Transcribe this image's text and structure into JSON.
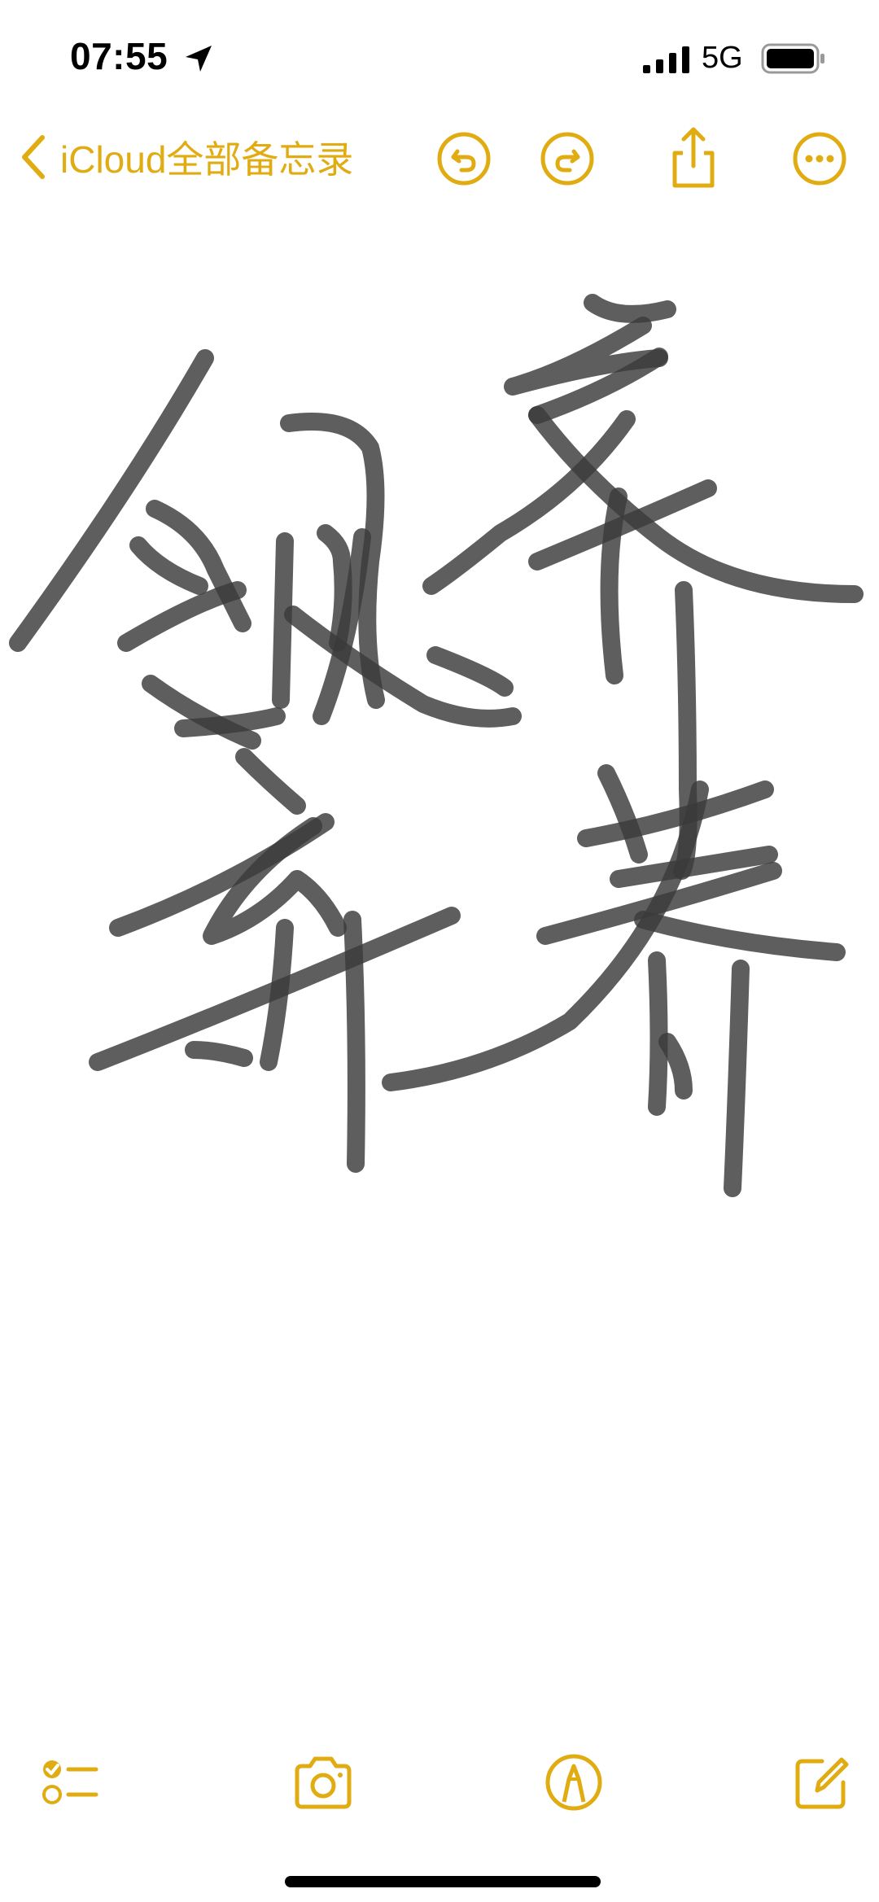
{
  "status_bar": {
    "time": "07:55",
    "network": "5G",
    "icons": [
      "location-arrow-icon",
      "cellular-signal-icon",
      "battery-icon"
    ]
  },
  "nav": {
    "back_label": "iCloud全部备忘录",
    "icons": [
      "chevron-left-icon",
      "undo-icon",
      "redo-icon",
      "share-icon",
      "more-icon"
    ]
  },
  "note": {
    "content_type": "handwritten drawing",
    "ink_color": "#3a3a3a"
  },
  "toolbar": {
    "icons": [
      "checklist-icon",
      "camera-icon",
      "markup-pen-icon",
      "compose-icon"
    ]
  },
  "colors": {
    "accent": "#e0ac12",
    "background": "#ffffff",
    "text": "#000000"
  }
}
